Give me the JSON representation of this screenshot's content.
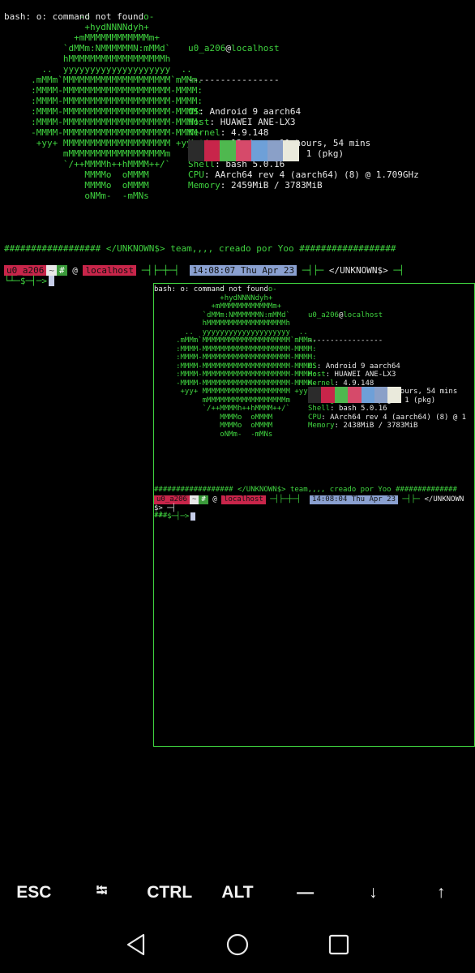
{
  "terminal": {
    "bash_error": "bash: o: command not found",
    "ascii_logo": [
      "",
      "              -o          o-",
      "               +hydNNNNdyh+",
      "             +mMMMMMMMMMMMMm+",
      "           `dMMm:NMMMMMMN:mMMd`",
      "           hMMMMMMMMMMMMMMMMMMh",
      "       ..  yyyyyyyyyyyyyyyyyyyy  ..",
      "     .mMMm`MMMMMMMMMMMMMMMMMMMM`mMMm.",
      "     :MMMM-MMMMMMMMMMMMMMMMMMMM-MMMM:",
      "     :MMMM-MMMMMMMMMMMMMMMMMMMM-MMMM:",
      "     :MMMM-MMMMMMMMMMMMMMMMMMMM-MMMM:",
      "     :MMMM-MMMMMMMMMMMMMMMMMMMM-MMMM:",
      "     -MMMM-MMMMMMMMMMMMMMMMMMMM-MMMM-",
      "      +yy+ MMMMMMMMMMMMMMMMMMMM +yy+",
      "           mMMMMMMMMMMMMMMMMMMm",
      "           `/++MMMMh++hMMMM++/`",
      "               MMMMo  oMMMM",
      "               MMMMo  oMMMM",
      "               oNMm-  -mMNs"
    ],
    "user_host": {
      "user": "u0_a206",
      "at": "@",
      "host": "localhost"
    },
    "separator": "-----------------",
    "info": [
      {
        "key": "OS",
        "value": "Android 9 aarch64"
      },
      {
        "key": "Host",
        "value": "HUAWEI ANE-LX3"
      },
      {
        "key": "Kernel",
        "value": "4.9.148"
      },
      {
        "key": "Uptime",
        "value": "13 days, 11 hours, 54 mins"
      },
      {
        "key": "Packages",
        "value": "121 (dpkg), 1 (pkg)"
      },
      {
        "key": "Shell",
        "value": "bash 5.0.16"
      },
      {
        "key": "CPU",
        "value": "AArch64 rev 4 (aarch64) (8) @ 1.709GHz"
      },
      {
        "key": "Memory",
        "value": "2459MiB / 3783MiB"
      }
    ],
    "palette_colors": [
      "#2b2b2b",
      "#c8254a",
      "#4fb84f",
      "#d64a6a",
      "#6ea0d8",
      "#8aa0c8",
      "#eaeadc"
    ],
    "banner": "################## </UNKNOWN$> team,,,, creado por Yoo ##################",
    "prompt": {
      "user": "u0_a206",
      "dir": "~",
      "hash": "#",
      "at": "@",
      "host": "localhost",
      "sep1": "─┤├─┼─┤",
      "time": "14:08:07 Thu Apr 23",
      "sep2": "─┤├─",
      "unknown": "</UNKNOWN$>",
      "sep3": "─┤",
      "second_line": "└┴─$─┤─>"
    }
  },
  "nested_window": {
    "bash_error": "bash: o: command not found",
    "user_host": {
      "user": "u0_a206",
      "at": "@",
      "host": "localhost"
    },
    "separator": "-----------------",
    "info": [
      {
        "key": "OS",
        "value": "Android 9 aarch64"
      },
      {
        "key": "Host",
        "value": "HUAWEI ANE-LX3"
      },
      {
        "key": "Kernel",
        "value": "4.9.148"
      },
      {
        "key": "Uptime",
        "value": "13 days, 11 hours, 54 mins"
      },
      {
        "key": "Packages",
        "value": "121 (dpkg), 1 (pkg)"
      },
      {
        "key": "Shell",
        "value": "bash 5.0.16"
      },
      {
        "key": "CPU",
        "value": "AArch64 rev 4 (aarch64) (8) @ 1"
      },
      {
        "key": "Memory",
        "value": "2438MiB / 3783MiB"
      }
    ],
    "banner_line1": "################## </UNKNOWN$> team,,,, creado por Yoo ##############",
    "banner_line2": "###",
    "prompt": {
      "user": "u0_a206",
      "dir": "~",
      "hash": "#",
      "at": "@",
      "host": "localhost",
      "sep1": "─┤├─┼─┤",
      "time": "14:08:04 Thu Apr 23",
      "sep2": "─┤├─",
      "unknown": "</UNKNOWN",
      "wrap": "$> ─┤",
      "second_line": "└┴─$─┤─>"
    }
  },
  "extra_keys": [
    "ESC",
    "⭾",
    "CTRL",
    "ALT",
    "—",
    "↓",
    "↑"
  ],
  "navbar": [
    "back-icon",
    "home-icon",
    "recents-icon"
  ]
}
